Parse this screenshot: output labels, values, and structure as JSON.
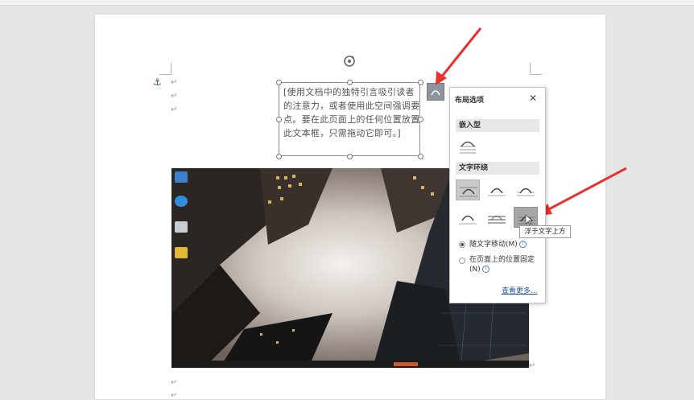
{
  "document": {
    "quote_text": "[使用文档中的独特引言吸引读者的注意力，或者使用此空间强调要点。要在此页面上的任何位置放置此文本框，只需拖动它即可。]",
    "paragraph_mark": "↵"
  },
  "layout_panel": {
    "title": "布局选项",
    "close_glyph": "✕",
    "inline_section": "嵌入型",
    "wrap_section": "文字环绕",
    "move_with_text": "随文字移动(M)",
    "fix_position": "在页面上的位置固定(N)",
    "see_more": "查看更多...",
    "move_with_text_selected": true
  },
  "tooltip": {
    "text": "浮于文字上方"
  },
  "icons": [
    "anchor-icon",
    "rotate-icon",
    "layout-options-icon",
    "close-icon",
    "info-icon"
  ],
  "colors": {
    "arrow": "#e8302e",
    "link": "#2b579a",
    "anchor": "#2b5797"
  }
}
